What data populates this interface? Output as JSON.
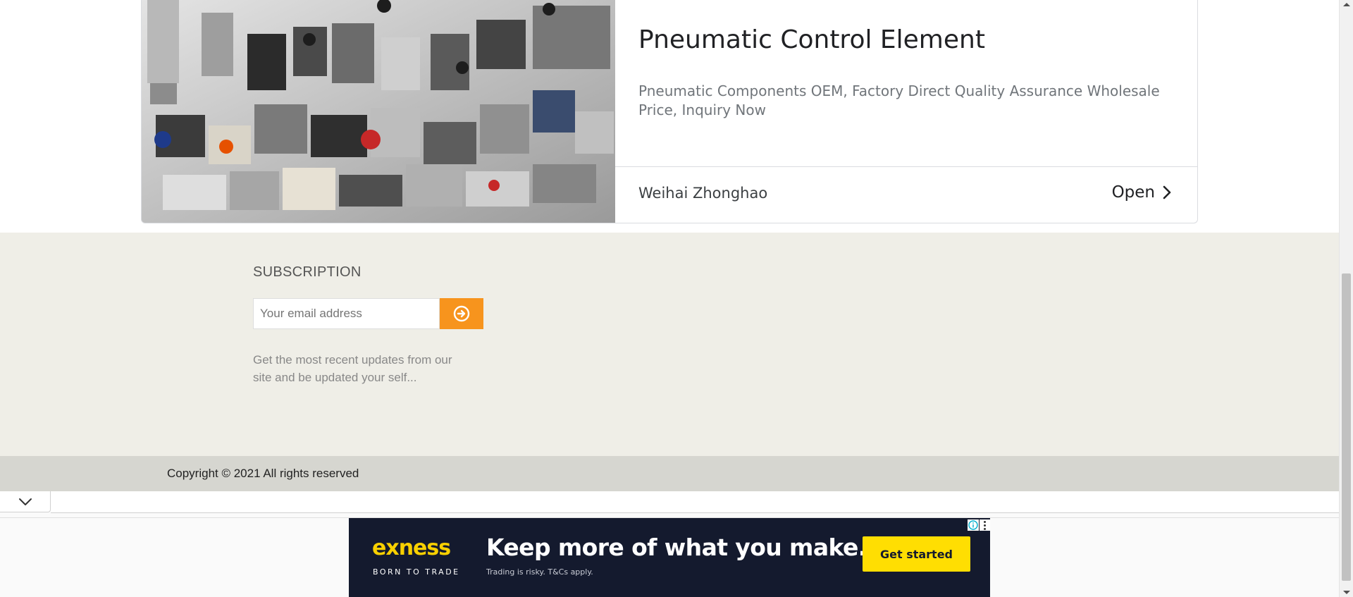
{
  "ad_card": {
    "title": "Pneumatic Control Element",
    "description": "Pneumatic Components OEM, Factory Direct Quality Assurance Wholesale Price, Inquiry Now",
    "advertiser": "Weihai Zhonghao",
    "open_label": "Open",
    "image_icon": "pneumatic-components-photo"
  },
  "subscription": {
    "title": "SUBSCRIPTION",
    "email_placeholder": "Your email address",
    "submit_icon": "circle-arrow-right-icon",
    "description": "Get the most recent updates from our site and be updated your self..."
  },
  "footer": {
    "copyright": "Copyright © 2021 All rights reserved"
  },
  "anchor_ad": {
    "collapse_icon": "chevron-down-icon",
    "brand": "exness",
    "tagline": "BORN TO TRADE",
    "headline": "Keep more of what you make.",
    "disclaimer": "Trading is risky. T&Cs apply.",
    "cta": "Get started",
    "adchoices_icon": "info-icon",
    "menu_icon": "kebab-menu-icon"
  },
  "colors": {
    "accent_orange": "#f7941d",
    "brand_yellow": "#f9d000",
    "cta_yellow": "#ffde02",
    "banner_bg": "#141a2e",
    "subscribe_bg": "#efeee7",
    "copyright_bg": "#d6d6d0"
  }
}
